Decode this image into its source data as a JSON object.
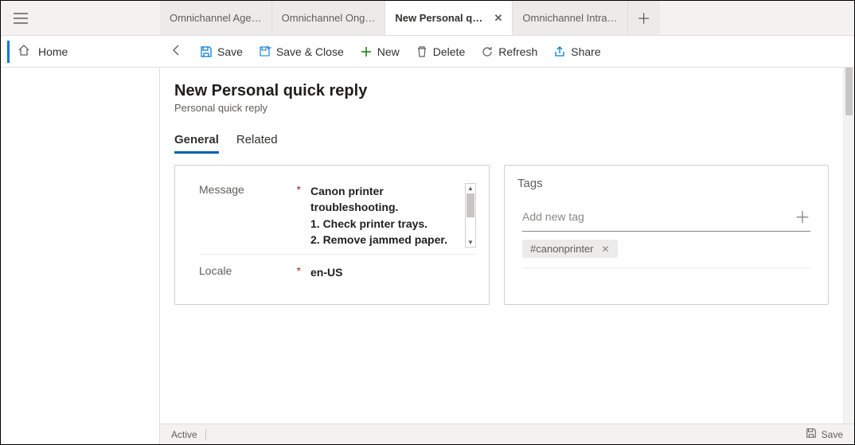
{
  "tabs": [
    {
      "label": "Omnichannel Age…"
    },
    {
      "label": "Omnichannel Ong…"
    },
    {
      "label": "New Personal quick reply",
      "active": true
    },
    {
      "label": "Omnichannel Intra…"
    }
  ],
  "sidebar": {
    "home_label": "Home"
  },
  "toolbar": {
    "save": "Save",
    "save_close": "Save & Close",
    "new": "New",
    "delete": "Delete",
    "refresh": "Refresh",
    "share": "Share"
  },
  "page": {
    "title": "New Personal quick reply",
    "subtitle": "Personal quick reply"
  },
  "form_tabs": {
    "general": "General",
    "related": "Related"
  },
  "fields": {
    "message_label": "Message",
    "message_value": "Canon printer troubleshooting.\n1. Check printer trays.\n2. Remove jammed paper.",
    "locale_label": "Locale",
    "locale_value": "en-US"
  },
  "tags": {
    "title": "Tags",
    "placeholder": "Add new tag",
    "items": [
      "#canonprinter"
    ]
  },
  "status": {
    "state": "Active",
    "save": "Save"
  }
}
